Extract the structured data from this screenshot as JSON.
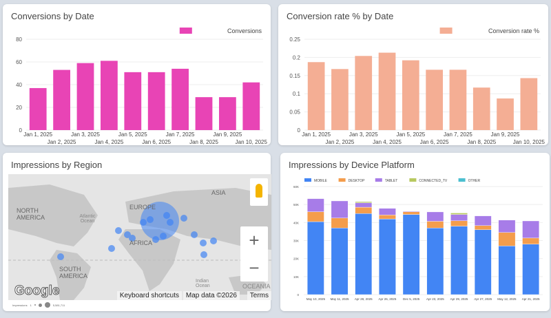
{
  "colors": {
    "conversions": "#e844b5",
    "rate": "#f4ae94",
    "mobile": "#4285f4",
    "desktop": "#f49d4c",
    "tablet": "#a77ce8",
    "ctv": "#b8c960",
    "other": "#4cbfd0"
  },
  "chart_data": [
    {
      "type": "bar",
      "title": "Conversions by Date",
      "legend": "Conversions",
      "categories": [
        "Jan 1, 2025",
        "Jan 2, 2025",
        "Jan 3, 2025",
        "Jan 4, 2025",
        "Jan 5, 2025",
        "Jan 6, 2025",
        "Jan 7, 2025",
        "Jan 8, 2025",
        "Jan 9, 2025",
        "Jan 10, 2025"
      ],
      "values": [
        37,
        53,
        59,
        61,
        51,
        51,
        54,
        29,
        29,
        42
      ],
      "ylim": [
        0,
        80
      ],
      "yticks": [
        "0",
        "20",
        "40",
        "60",
        "80"
      ],
      "legend_position": "top-right",
      "grid": true
    },
    {
      "type": "bar",
      "title": "Conversion rate % by Date",
      "legend": "Conversion rate %",
      "categories": [
        "Jan 1, 2025",
        "Jan 2, 2025",
        "Jan 3, 2025",
        "Jan 4, 2025",
        "Jan 5, 2025",
        "Jan 6, 2025",
        "Jan 7, 2025",
        "Jan 8, 2025",
        "Jan 9, 2025",
        "Jan 10, 2025"
      ],
      "values": [
        0.187,
        0.168,
        0.204,
        0.213,
        0.192,
        0.166,
        0.166,
        0.117,
        0.087,
        0.143
      ],
      "ylim": [
        0,
        0.25
      ],
      "yticks": [
        "0",
        "0.05",
        "0.1",
        "0.15",
        "0.2",
        "0.25"
      ],
      "legend_position": "top-right",
      "grid": true
    },
    {
      "type": "bar",
      "stacked": true,
      "title": "Impressions by Device Platform",
      "categories": [
        "May 10, 2025",
        "May 11, 2025",
        "Apr 28, 2025",
        "Apr 26, 2025",
        "Dec 5, 2025",
        "Apr 23, 2025",
        "Apr 29, 2025",
        "Apr 27, 2025",
        "May 12, 2025",
        "Apr 21, 2025"
      ],
      "ylim": [
        0,
        60000
      ],
      "yticks": [
        "0",
        "10K",
        "20K",
        "30K",
        "40K",
        "50K",
        "60K"
      ],
      "legend_position": "top-left",
      "grid": true,
      "series": [
        {
          "name": "MOBILE",
          "values": [
            40500,
            37000,
            45000,
            42000,
            44500,
            37000,
            38000,
            36000,
            27000,
            28000
          ]
        },
        {
          "name": "DESKTOP",
          "values": [
            5500,
            5500,
            3500,
            2200,
            1500,
            3700,
            3000,
            2300,
            7500,
            3400
          ]
        },
        {
          "name": "TABLET",
          "values": [
            7300,
            9500,
            2500,
            3700,
            300,
            5200,
            3500,
            5400,
            6900,
            9500
          ]
        },
        {
          "name": "CONNECTED_TV",
          "values": [
            100,
            0,
            600,
            0,
            0,
            0,
            800,
            0,
            0,
            0
          ]
        },
        {
          "name": "OTHER",
          "values": [
            0,
            0,
            0,
            0,
            0,
            0,
            0,
            0,
            0,
            0
          ]
        }
      ]
    }
  ],
  "map": {
    "title": "Impressions by Region",
    "labels": [
      "NORTH AMERICA",
      "Atlantic Ocean",
      "EUROPE",
      "AFRICA",
      "ASIA",
      "SOUTH AMERICA",
      "Indian Ocean",
      "OCEANIA"
    ],
    "keyboard": "Keyboard shortcuts",
    "mapdata": "Map data ©2026",
    "terms": "Terms",
    "logo": "Google",
    "legend_label": "Impressions",
    "legend_min": "1",
    "legend_max": "5,581,711",
    "zoom_in": "+",
    "zoom_out": "−"
  }
}
